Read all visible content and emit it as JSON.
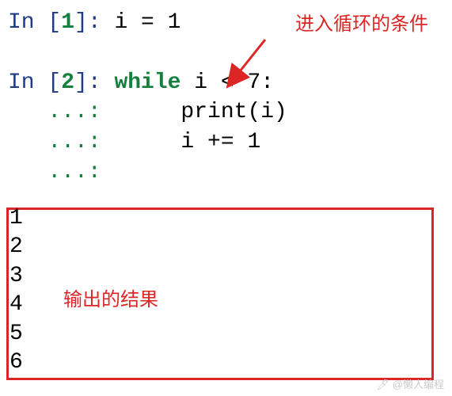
{
  "cells": {
    "cell1": {
      "in_label": "In [",
      "num": "1",
      "close": "]: ",
      "code": "i = 1"
    },
    "cell2": {
      "in_label": "In [",
      "num": "2",
      "close": "]: ",
      "keyword": "while",
      "condition": " i < 7:",
      "cont": "   ...: ",
      "line2": "     print(i)",
      "line3": "     i += 1",
      "line4": ""
    }
  },
  "annotations": {
    "top": "进入循环的条件",
    "mid": "输出的结果"
  },
  "output": [
    "1",
    "2",
    "3",
    "4",
    "5",
    "6"
  ],
  "watermark": "🖊 @懒人编程"
}
